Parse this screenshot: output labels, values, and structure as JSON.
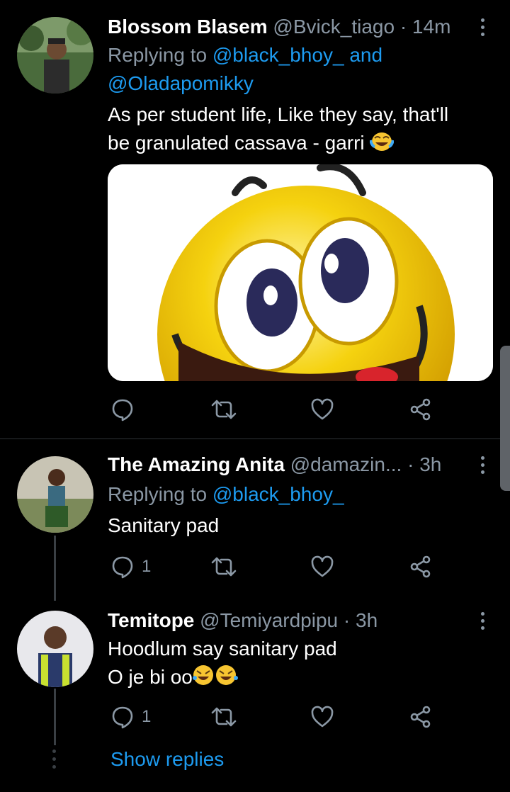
{
  "tweets": [
    {
      "name": "Blossom Blasem",
      "handle": "@Bvick_tiago",
      "dot": "·",
      "time": "14m",
      "replying_prefix": "Replying to",
      "replying_to_1": "@black_bhoy_",
      "replying_and": "and",
      "replying_to_2": "@Oladapomikky",
      "text_line1": "As per student life, Like they say, that'll",
      "text_line2": "be granulated cassava - garri",
      "emoji": "laughing-tears-emoji",
      "media": "emoji-face-image"
    },
    {
      "name": "The Amazing Anita",
      "handle": "@damazin...",
      "dot": "·",
      "time": "3h",
      "replying_prefix": "Replying to",
      "replying_to_1": "@black_bhoy_",
      "text_line1": "Sanitary pad",
      "reply_count": "1"
    },
    {
      "name": "Temitope",
      "handle": "@Temiyardpipu",
      "dot": "·",
      "time": "3h",
      "text_line1": "Hoodlum say sanitary pad",
      "text_line2": "O je bi oo",
      "emoji": "rolling-laughing-emoji",
      "reply_count": "1"
    }
  ],
  "show_replies": "Show replies",
  "colors": {
    "background": "#000000",
    "link": "#1d9bf0",
    "secondary": "#8b98a5",
    "divider": "#2f3336"
  }
}
